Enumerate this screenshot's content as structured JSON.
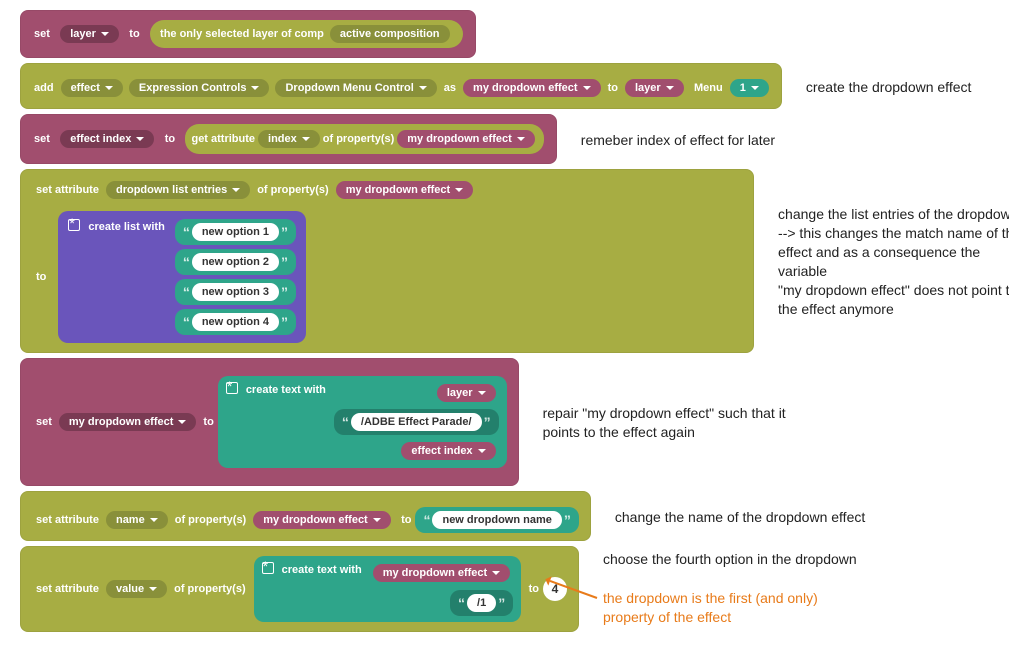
{
  "b1": {
    "set": "set",
    "layer": "layer",
    "to": "to",
    "selected_label": "the only selected layer of comp",
    "active_comp": "active composition"
  },
  "b2": {
    "add": "add",
    "effect": "effect",
    "expr_ctrl": "Expression Controls",
    "ddmenu": "Dropdown Menu Control",
    "as": "as",
    "mydd": "my dropdown effect",
    "to": "to",
    "layer": "layer",
    "menu": "Menu",
    "one": "1"
  },
  "b3": {
    "set": "set",
    "effect_index": "effect index",
    "to": "to",
    "get_attr": "get attribute",
    "index": "index",
    "of_prop": "of property(s)",
    "mydd": "my dropdown effect"
  },
  "b4": {
    "set_attr": "set attribute",
    "dd_entries": "dropdown list entries",
    "of_prop": "of property(s)",
    "mydd": "my dropdown effect",
    "create_list": "create list with",
    "to": "to",
    "opt1": "new option 1",
    "opt2": "new option 2",
    "opt3": "new option 3",
    "opt4": "new option 4"
  },
  "b5": {
    "set": "set",
    "mydd": "my dropdown effect",
    "to": "to",
    "create_text": "create text with",
    "layer": "layer",
    "path": "/ADBE Effect Parade/",
    "effect_index": "effect index"
  },
  "b6": {
    "set_attr": "set attribute",
    "name": "name",
    "of_prop": "of property(s)",
    "mydd": "my dropdown effect",
    "to": "to",
    "new_name": "new dropdown name"
  },
  "b7": {
    "set_attr": "set attribute",
    "value": "value",
    "of_prop": "of property(s)",
    "create_text": "create text with",
    "mydd": "my dropdown effect",
    "slash1": "/1",
    "to": "to",
    "four": "4"
  },
  "ann": {
    "a1": "create the dropdown effect",
    "a2": "remeber index of effect for later",
    "a3": "change the list entries of the dropdown\n--> this changes the match name of the\neffect and as a consequence the variable\n\"my dropdown effect\" does not point to\nthe effect anymore",
    "a4": "repair \"my dropdown effect\" such that it\npoints to the effect again",
    "a5": "change the name of the dropdown effect",
    "a6": "choose the fourth option in the dropdown",
    "a7": "the dropdown is the first (and only)\nproperty of the effect"
  }
}
